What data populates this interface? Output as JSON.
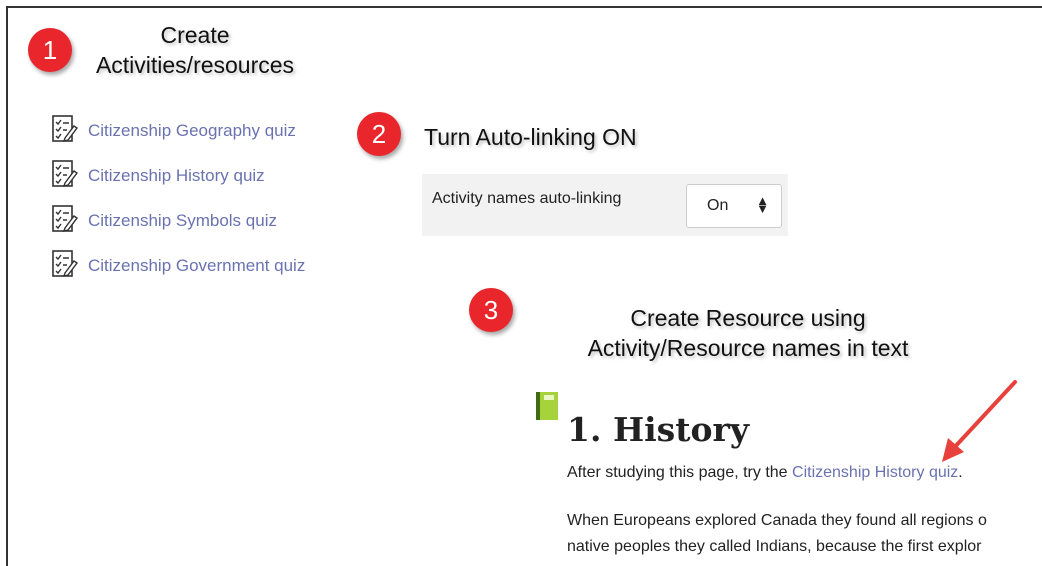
{
  "steps": [
    {
      "number": "1",
      "title_line1": "Create",
      "title_line2": "Activities/resources"
    },
    {
      "number": "2",
      "title": "Turn Auto-linking ON"
    },
    {
      "number": "3",
      "title_line1": "Create Resource using",
      "title_line2": "Activity/Resource names in text"
    }
  ],
  "activities": [
    {
      "label": "Citizenship Geography quiz",
      "icon": "quiz-icon"
    },
    {
      "label": "Citizenship History quiz",
      "icon": "quiz-icon"
    },
    {
      "label": "Citizenship Symbols quiz",
      "icon": "quiz-icon"
    },
    {
      "label": "Citizenship Government quiz",
      "icon": "quiz-icon"
    }
  ],
  "setting": {
    "label": "Activity names auto-linking",
    "value": "On",
    "arrow_icon": "sort-arrows-icon"
  },
  "resource": {
    "icon": "book-icon",
    "heading": "1. History",
    "para1_before": "After studying this page, try the ",
    "para1_link": "Citizenship History quiz",
    "para1_after": ".",
    "para2_line1": "When Europeans explored Canada they found all regions o",
    "para2_line2": "native peoples they called Indians, because the first explor"
  },
  "colors": {
    "badge": "#e8262c",
    "link": "#6a72b0",
    "arrow": "#e8413c"
  }
}
